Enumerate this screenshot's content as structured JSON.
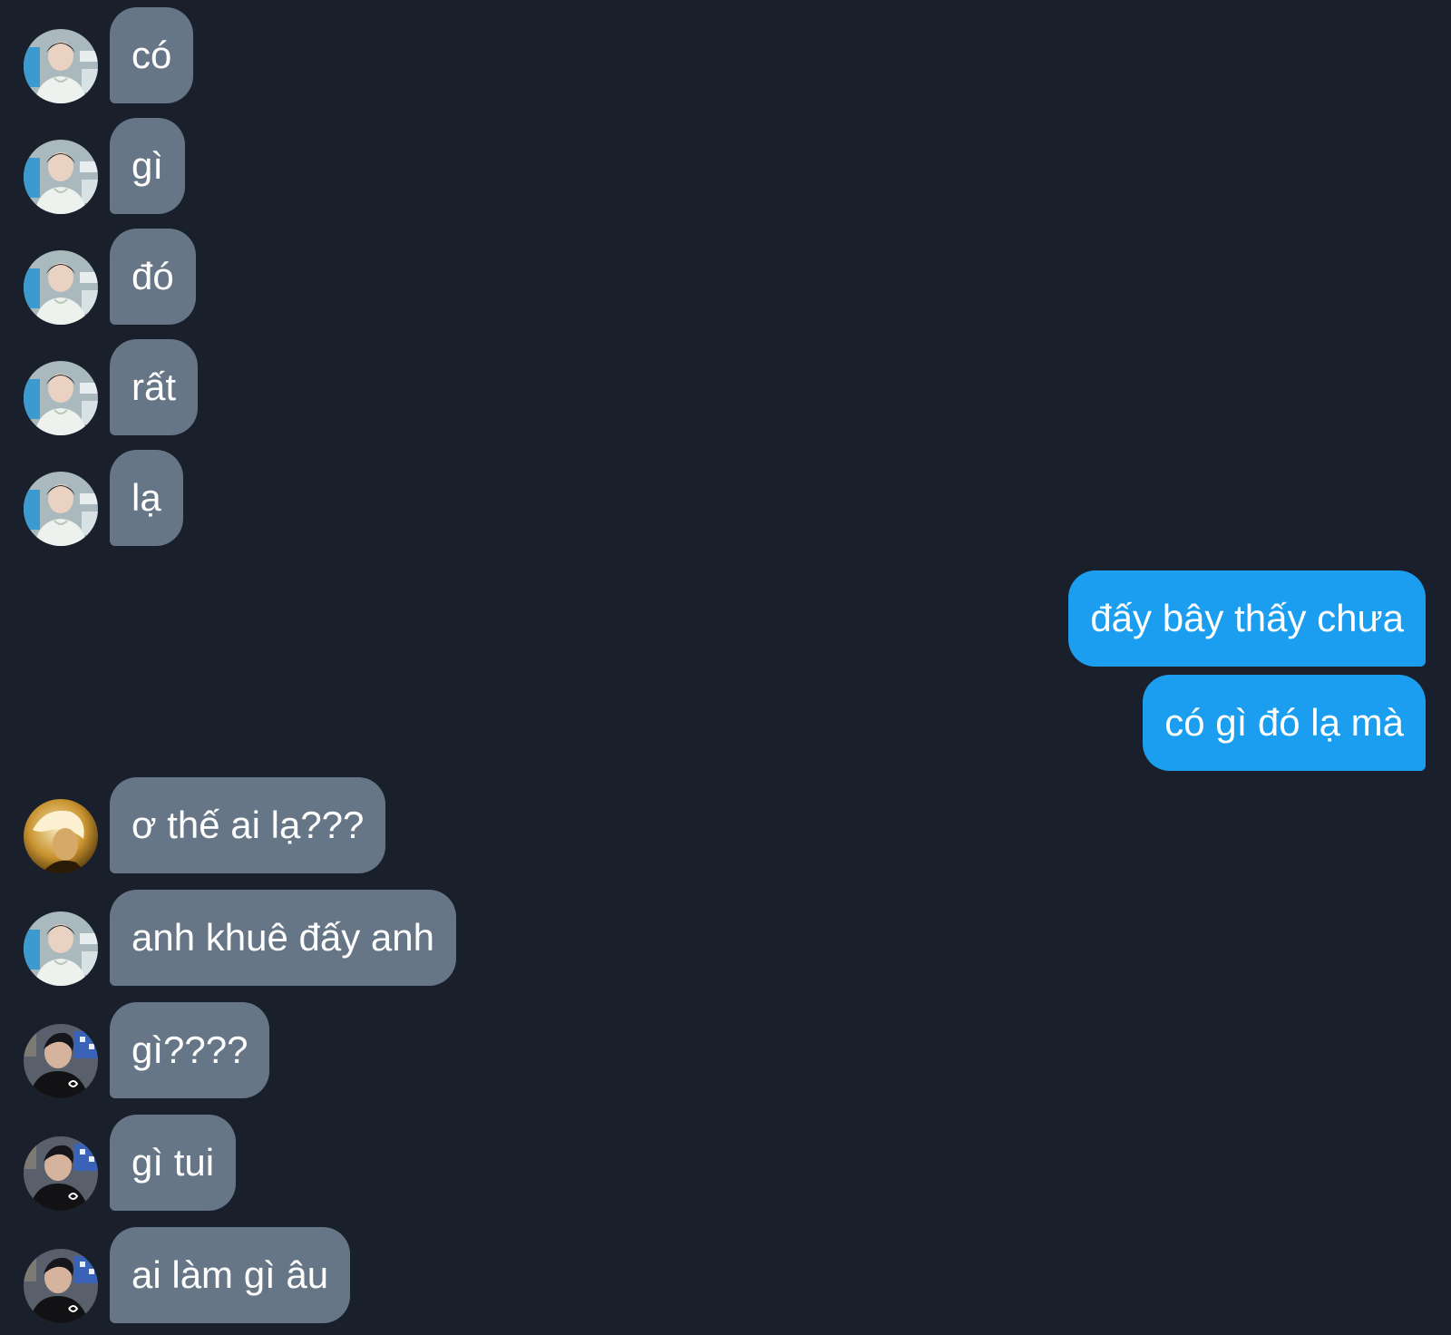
{
  "messages": [
    {
      "side": "in",
      "avatar": "avatar-white-shirt",
      "text": "có"
    },
    {
      "side": "in",
      "avatar": "avatar-white-shirt",
      "text": "gì"
    },
    {
      "side": "in",
      "avatar": "avatar-white-shirt",
      "text": "đó"
    },
    {
      "side": "in",
      "avatar": "avatar-white-shirt",
      "text": "rất"
    },
    {
      "side": "in",
      "avatar": "avatar-white-shirt",
      "text": "lạ"
    },
    {
      "side": "out",
      "text": "đấy bây thấy chưa"
    },
    {
      "side": "out",
      "text": "có gì đó lạ mà"
    },
    {
      "side": "in",
      "avatar": "avatar-blonde",
      "text": "ơ thế ai lạ???"
    },
    {
      "side": "in",
      "avatar": "avatar-white-shirt",
      "text": "anh khuê đấy anh"
    },
    {
      "side": "in",
      "avatar": "avatar-black-shirt",
      "text": "gì????"
    },
    {
      "side": "in",
      "avatar": "avatar-black-shirt",
      "text": "gì tui"
    },
    {
      "side": "in",
      "avatar": "avatar-black-shirt",
      "text": "ai làm gì âu"
    }
  ],
  "colors": {
    "background": "#19202b",
    "incoming_bubble": "#667687",
    "outgoing_bubble": "#1b9ef0",
    "text": "#ffffff"
  }
}
